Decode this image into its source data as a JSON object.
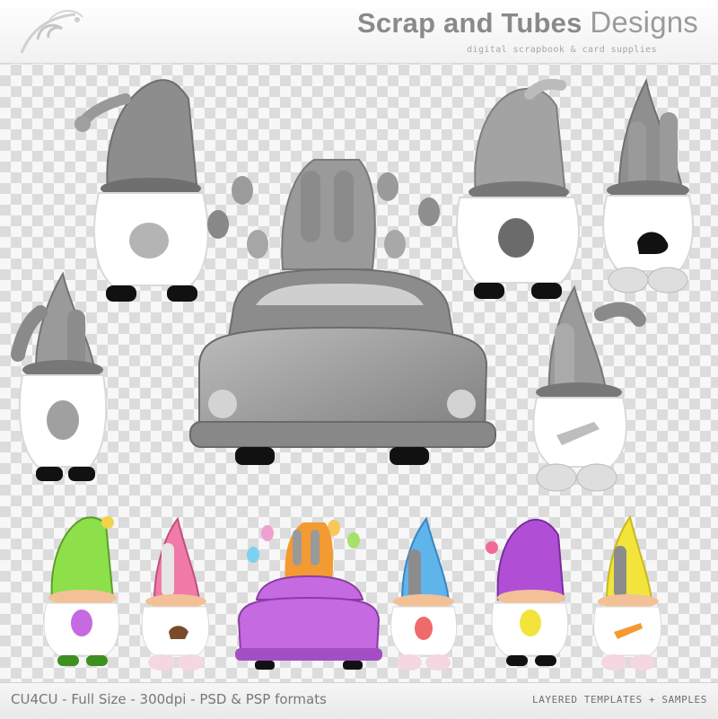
{
  "brand": {
    "title_bold": "Scrap and Tubes",
    "title_light": "Designs",
    "tagline": "digital scrapbook & card supplies"
  },
  "footer": {
    "left_text": "CU4CU - Full Size - 300dpi - PSD & PSP formats",
    "right_text": "LAYERED TEMPLATES + SAMPLES"
  },
  "colors": {
    "checker_light": "#f7f7f7",
    "checker_dark": "#dcdcdc",
    "template_gray": "#9a9a9a",
    "gnome_hat_green": "#8ee04a",
    "gnome_hat_pink": "#f07aa8",
    "gnome_hat_orange": "#f49a32",
    "car_purple": "#c56ae0",
    "gnome_hat_blue": "#5fb4ec",
    "gnome_hat_purple": "#b04fd6",
    "gnome_hat_yellow": "#f3e43c"
  },
  "artwork": {
    "templates": [
      "gnome-polka-hat",
      "bunny-gnome-car-juggling",
      "gnome-polka-hat-2",
      "bunny-gnome-sitting",
      "bunny-gnome-egg",
      "bunny-gnome-carrot"
    ],
    "samples": [
      "green-gnome",
      "pink-bunny-gnome",
      "purple-car-gnome",
      "blue-bunny-gnome",
      "purple-gnome",
      "yellow-bunny-gnome"
    ]
  }
}
